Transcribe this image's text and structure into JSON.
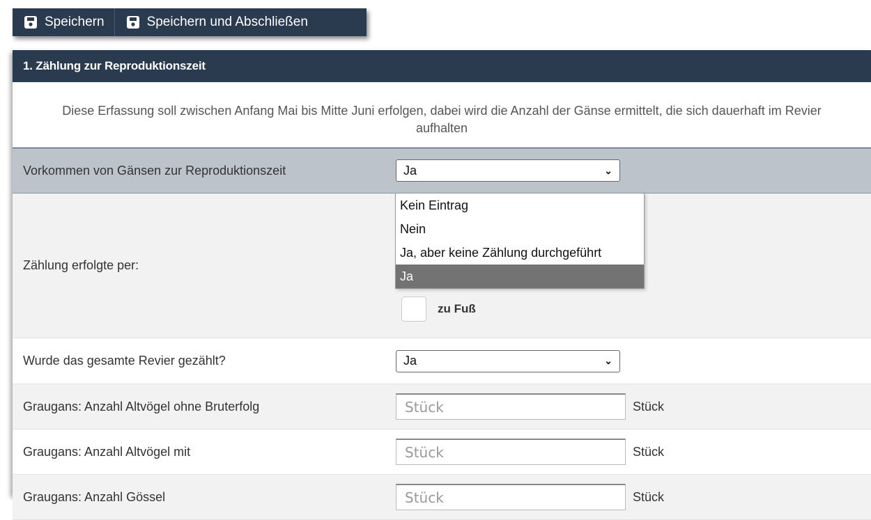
{
  "toolbar": {
    "save_label": "Speichern",
    "save_close_label": "Speichern und Abschließen"
  },
  "section": {
    "title": "1. Zählung zur Reproduktionszeit",
    "intro": "Diese Erfassung soll zwischen Anfang Mai bis Mitte Juni erfolgen, dabei wird die Anzahl der Gänse ermittelt, die sich dauerhaft im Revier aufhalten"
  },
  "fields": {
    "vorkommen": {
      "label": "Vorkommen von Gänsen zur Reproduktionszeit",
      "value": "Ja"
    },
    "zaehlung_per": {
      "label": "Zählung erfolgte per:",
      "checkbox_label": "zu Fuß"
    },
    "gesamtes_revier": {
      "label": "Wurde das gesamte Revier gezählt?",
      "value": "Ja"
    },
    "ohne_bruterfolg": {
      "label": "Graugans: Anzahl Altvögel ohne Bruterfolg",
      "placeholder": "Stück",
      "unit": "Stück"
    },
    "mit_bruterfolg": {
      "label": "Graugans: Anzahl Altvögel mit",
      "placeholder": "Stück",
      "unit": "Stück"
    },
    "goessel": {
      "label": "Graugans: Anzahl Gössel",
      "placeholder": "Stück",
      "unit": "Stück"
    }
  },
  "dropdown": {
    "options": [
      "Kein Eintrag",
      "Nein",
      "Ja, aber keine Zählung durchgeführt",
      "Ja"
    ],
    "selected": "Ja"
  },
  "colors": {
    "header": "#2b3b4f",
    "active_row": "#bcc3cb",
    "selected_option": "#737373"
  }
}
